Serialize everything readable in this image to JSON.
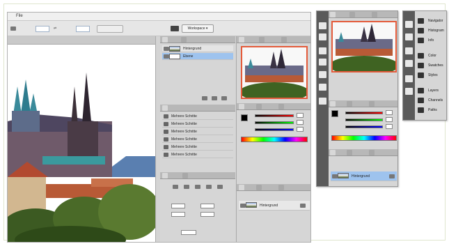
{
  "app": {
    "menu_first": "File",
    "workspace_label": "Workspace ▾"
  },
  "layers_panel": {
    "layers": [
      {
        "name": "Hintergrund"
      },
      {
        "name": "Ebene"
      }
    ]
  },
  "history_panel": {
    "items": [
      "Mehrere Schritte",
      "Mehrere Schritte",
      "Mehrere Schritte",
      "Mehrere Schritte",
      "Mehrere Schritte",
      "Mehrere Schritte"
    ],
    "footer": ""
  },
  "dock_layers_bottom": {
    "layer_name": "Hintergrund"
  },
  "floating_layers": {
    "layer_name": "Hintergrund"
  },
  "floating_nav": {
    "items": [
      {
        "icon": "navigator-icon",
        "label": "Navigator"
      },
      {
        "icon": "histogram-icon",
        "label": "Histogram"
      },
      {
        "icon": "info-icon",
        "label": "Info"
      },
      {
        "icon": "color-icon",
        "label": "Color"
      },
      {
        "icon": "swatches-icon",
        "label": "Swatches"
      },
      {
        "icon": "styles-icon",
        "label": "Styles"
      },
      {
        "icon": "layers-icon",
        "label": "Layers"
      },
      {
        "icon": "channels-icon",
        "label": "Channels"
      },
      {
        "icon": "paths-icon",
        "label": "Paths"
      }
    ]
  },
  "colors": {
    "accent_highlight": "#e45a3a",
    "selection": "#9ec3ee"
  }
}
